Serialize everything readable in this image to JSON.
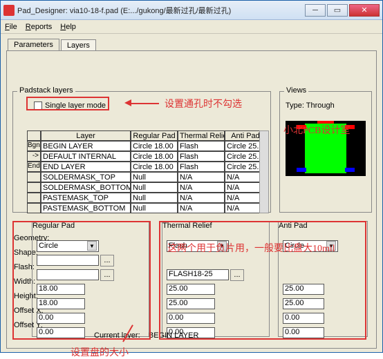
{
  "window": {
    "title": "Pad_Designer: via10-18-f.pad (E:.../gukong/最新过孔/最新过孔)"
  },
  "menu": {
    "file": "File",
    "reports": "Reports",
    "help": "Help"
  },
  "tabs": {
    "parameters": "Parameters",
    "layers": "Layers"
  },
  "padstack": {
    "legend": "Padstack layers",
    "single_layer_mode": "Single layer mode",
    "headers": {
      "layer": "Layer",
      "regular": "Regular Pad",
      "thermal": "Thermal Relief",
      "anti": "Anti Pad"
    },
    "side_labels": [
      "Bgn",
      "->",
      "End",
      "",
      "",
      "",
      ""
    ],
    "rows": [
      {
        "layer": "BEGIN LAYER",
        "reg": "Circle 18.00",
        "th": "Flash",
        "anti": "Circle 25.00"
      },
      {
        "layer": "DEFAULT INTERNAL",
        "reg": "Circle 18.00",
        "th": "Flash",
        "anti": "Circle 25.00"
      },
      {
        "layer": "END LAYER",
        "reg": "Circle 18.00",
        "th": "Flash",
        "anti": "Circle 25.00"
      },
      {
        "layer": "SOLDERMASK_TOP",
        "reg": "Null",
        "th": "N/A",
        "anti": "N/A"
      },
      {
        "layer": "SOLDERMASK_BOTTOM",
        "reg": "Null",
        "th": "N/A",
        "anti": "N/A"
      },
      {
        "layer": "PASTEMASK_TOP",
        "reg": "Null",
        "th": "N/A",
        "anti": "N/A"
      },
      {
        "layer": "PASTEMASK_BOTTOM",
        "reg": "Null",
        "th": "N/A",
        "anti": "N/A"
      }
    ]
  },
  "views": {
    "legend": "Views",
    "type_label": "Type:",
    "type_value": "Through"
  },
  "labels": {
    "geometry": "Geometry:",
    "shape": "Shape:",
    "flash": "Flash:",
    "width": "Width:",
    "height": "Height:",
    "offx": "Offset X:",
    "offy": "Offset Y:",
    "dots": "..."
  },
  "regular": {
    "legend": "Regular Pad",
    "geometry": "Circle",
    "shape": "",
    "flash": "",
    "width": "18.00",
    "height": "18.00",
    "offx": "0.00",
    "offy": "0.00"
  },
  "thermal": {
    "legend": "Thermal Relief",
    "geometry": "Flash",
    "flash": "FLASH18-25",
    "width": "25.00",
    "height": "25.00",
    "offx": "0.00",
    "offy": "0.00"
  },
  "anti": {
    "legend": "Anti Pad",
    "geometry": "Circle",
    "width": "25.00",
    "height": "25.00",
    "offx": "0.00",
    "offy": "0.00"
  },
  "current_layer_label": "Current layer:",
  "current_layer_value": "BEGIN LAYER",
  "annotations": {
    "a1": "设置通孔时不勾选",
    "a2": "小北PCB设计室",
    "a3": "这两个用于负片用，一般要比盘大10mil",
    "a4": "设置盘的大小"
  }
}
